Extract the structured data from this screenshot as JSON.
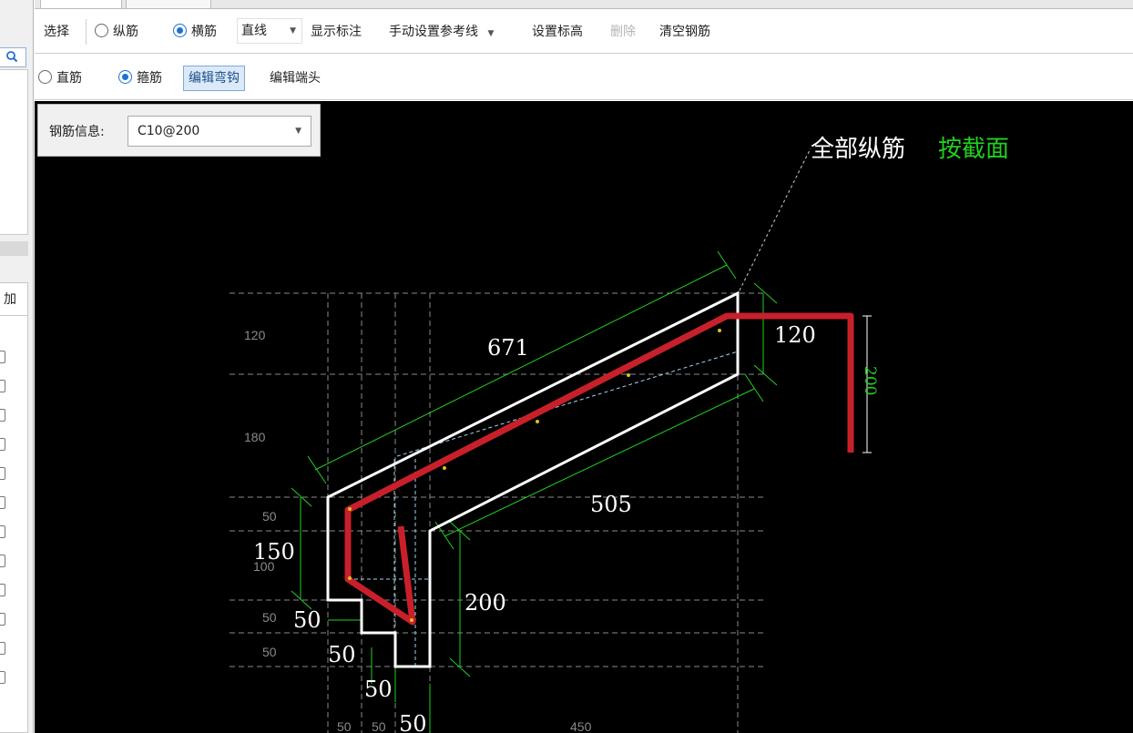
{
  "toolbar1": {
    "select_label": "选择",
    "longitudinal_label": "纵筋",
    "transverse_label": "横筋",
    "line_type_value": "直线",
    "show_annotation_label": "显示标注",
    "manual_ref_label": "手动设置参考线",
    "set_elevation_label": "设置标高",
    "delete_label": "删除",
    "clear_rebar_label": "清空钢筋"
  },
  "toolbar2": {
    "straight_label": "直筋",
    "stirrup_label": "箍筋",
    "edit_hook_label": "编辑弯钩",
    "edit_end_label": "编辑端头"
  },
  "left_panel": {
    "header_partial": "加"
  },
  "rebar_info": {
    "label": "钢筋信息:",
    "value": "C10@200"
  },
  "drawing": {
    "annotation_main": "全部纵筋",
    "annotation_green": "按截面",
    "dims": {
      "d671": "671",
      "d120": "120",
      "d200_vert": "200",
      "d505": "505",
      "d150": "150",
      "d200": "200",
      "d50_a": "50",
      "d50_b": "50",
      "d50_c": "50",
      "d50_d": "50"
    },
    "grid_labels": {
      "g120": "120",
      "g180": "180",
      "g50_a": "50",
      "g100": "100",
      "g50_b": "50",
      "g50_c": "50",
      "gb50_a": "50",
      "gb50_b": "50",
      "gb450": "450"
    }
  },
  "colors": {
    "rebar": "#c8202a",
    "outline": "#ffffff",
    "dimension": "#1fd11f",
    "grid": "#8a8a8a",
    "accent": "#1e6fd0"
  }
}
